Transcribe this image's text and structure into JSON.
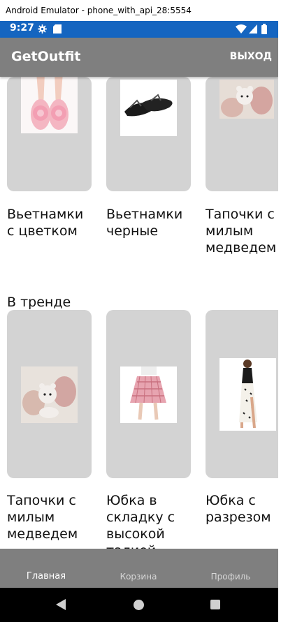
{
  "window": {
    "title": "Android Emulator - phone_with_api_28:5554"
  },
  "status_bar": {
    "time": "9:27"
  },
  "app_bar": {
    "title": "GetOutfit",
    "exit_label": "ВЫХОД"
  },
  "top_row": [
    {
      "caption": "Вьетнамки с цветком"
    },
    {
      "caption": "Вьетнамки черные"
    },
    {
      "caption": "Тапочки с милым медведем"
    }
  ],
  "trend": {
    "title": "В тренде",
    "items": [
      {
        "caption": "Тапочки с милым медведем"
      },
      {
        "caption": "Юбка в складку с высокой талией"
      },
      {
        "caption": "Юбка с разрезом"
      }
    ]
  },
  "bottom_nav": {
    "tabs": [
      "Главная",
      "Корзина",
      "Профиль"
    ]
  },
  "colors": {
    "status_bar": "#1565c0",
    "app_bar": "#7f7f7f",
    "card": "#d3d3d3"
  }
}
